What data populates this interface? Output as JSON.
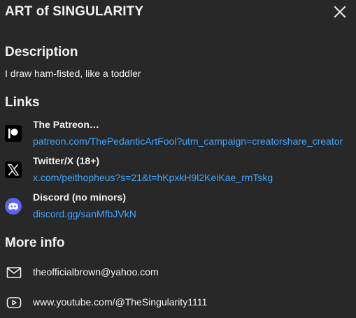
{
  "dialog": {
    "title": "ART of SINGULARITY",
    "close_icon": "close-icon"
  },
  "description": {
    "heading": "Description",
    "text": "I draw ham-fisted, like a toddler"
  },
  "links": {
    "heading": "Links",
    "items": [
      {
        "title": "The Patreon…",
        "url": "patreon.com/ThePedanticArtFool?utm_campaign=creatorshare_creator",
        "icon": "patreon-icon"
      },
      {
        "title": "Twitter/X (18+)",
        "url": "x.com/peithopheus?s=21&t=hKpxkH9l2KeiKae_rmTskg",
        "icon": "x-icon"
      },
      {
        "title": "Discord (no minors)",
        "url": "discord.gg/sanMfbJVkN",
        "icon": "discord-icon"
      }
    ]
  },
  "more_info": {
    "heading": "More info",
    "email": "theofficialbrown@yahoo.com",
    "email_icon": "mail-icon",
    "channel_url": "www.youtube.com/@TheSingularity1111",
    "channel_icon": "youtube-icon"
  },
  "colors": {
    "background": "#282828",
    "text": "#f1f1f1",
    "link": "#3ea6ff",
    "discord": "#5865f2"
  }
}
